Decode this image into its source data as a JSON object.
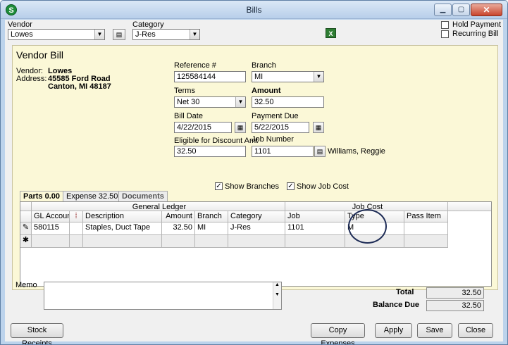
{
  "window": {
    "title": "Bills"
  },
  "top": {
    "vendor_label": "Vendor",
    "vendor_value": "Lowes",
    "category_label": "Category",
    "category_value": "J-Res",
    "hold_payment_label": "Hold Payment",
    "recurring_bill_label": "Recurring Bill"
  },
  "header": {
    "title": "Vendor Bill",
    "vendor_label": "Vendor:",
    "address_label": "Address:",
    "vendor_name": "Lowes",
    "address_line1": "45585 Ford Road",
    "address_line2": "Canton, MI  48187"
  },
  "form": {
    "reference_label": "Reference #",
    "reference_value": "125584144",
    "branch_label": "Branch",
    "branch_value": "MI",
    "terms_label": "Terms",
    "terms_value": "Net 30",
    "amount_label": "Amount",
    "amount_value": "32.50",
    "bill_date_label": "Bill Date",
    "bill_date_value": "4/22/2015",
    "payment_due_label": "Payment Due",
    "payment_due_value": "5/22/2015",
    "discount_label": "Eligible for Discount Amt",
    "discount_value": "32.50",
    "job_number_label": "Job Number",
    "job_number_value": "1101",
    "job_owner": "Williams, Reggie"
  },
  "tabs": [
    {
      "label": "Parts",
      "value": "0.00"
    },
    {
      "label": "Expense",
      "value": "32.50"
    },
    {
      "label": "Documents"
    }
  ],
  "options": {
    "show_branches_label": "Show Branches",
    "show_job_cost_label": "Show Job Cost",
    "show_branches_checked": true,
    "show_job_cost_checked": true
  },
  "grid": {
    "group_general_ledger": "General Ledger",
    "group_job_cost": "Job Cost",
    "columns": [
      "GL Account",
      "Description",
      "Amount",
      "Branch",
      "Category",
      "Job",
      "Type",
      "Pass Item"
    ],
    "row": {
      "gl_account": "580115",
      "description": "Staples, Duct Tape",
      "amount": "32.50",
      "branch": "MI",
      "category": "J-Res",
      "job": "1101",
      "type": "M",
      "pass_item": ""
    }
  },
  "memo": {
    "label": "Memo",
    "value": ""
  },
  "totals": {
    "total_label": "Total",
    "total_value": "32.50",
    "balance_label": "Balance Due",
    "balance_value": "32.50"
  },
  "buttons": {
    "stock_receipts": "Stock Receipts",
    "copy_expenses": "Copy Expenses",
    "apply": "Apply",
    "save": "Save",
    "close": "Close"
  }
}
